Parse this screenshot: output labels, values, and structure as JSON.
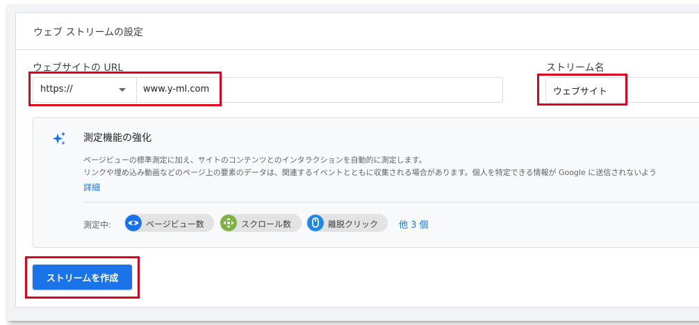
{
  "card": {
    "title": "ウェブ ストリームの設定"
  },
  "website_url": {
    "label": "ウェブサイトの URL",
    "protocol": "https://",
    "value": "www.y-ml.com"
  },
  "stream_name": {
    "label": "ストリーム名",
    "value": "ウェブサイト"
  },
  "enhanced_measurement": {
    "title": "測定機能の強化",
    "description_line1": "ページビューの標準測定に加え、サイトのコンテンツとのインタラクションを自動的に測定します。",
    "description_line2": "リンクや埋め込み動画などのページ上の要素のデータは、関連するイベントとともに収集される場合があります。個人を特定できる情報が Google に送信されないよう",
    "detail_link": "詳細",
    "measuring_label": "測定中:",
    "chips": [
      {
        "label": "ページビュー数",
        "icon": "eye-icon",
        "color": "#1a73e8"
      },
      {
        "label": "スクロール数",
        "icon": "scroll-icon",
        "color": "#7cb342"
      },
      {
        "label": "離脱クリック",
        "icon": "mouse-icon",
        "color": "#1e88e5"
      }
    ],
    "more_link": "他 3 個"
  },
  "create_button": {
    "label": "ストリームを作成",
    "color": "#1a73e8"
  },
  "highlight_color": "#e0001a"
}
